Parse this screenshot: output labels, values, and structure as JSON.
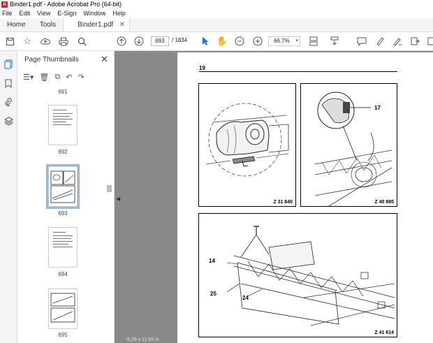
{
  "window": {
    "title": "Binder1.pdf - Adobe Acrobat Pro (64-bit)"
  },
  "menu": [
    "File",
    "Edit",
    "View",
    "E-Sign",
    "Window",
    "Help"
  ],
  "tabs": {
    "home": "Home",
    "tools": "Tools",
    "document": "Binder1.pdf"
  },
  "toolbar": {
    "current_page": "693",
    "page_count": "/ 1834",
    "zoom": "66.7%"
  },
  "thumbnails": {
    "title": "Page Thumbnails",
    "labels": [
      "691",
      "692",
      "693",
      "694",
      "695"
    ],
    "selected": "693"
  },
  "document_page": {
    "page_number": "19",
    "figures": {
      "top_left": {
        "ref": "Z 31 840"
      },
      "top_right": {
        "ref": "Z 40 985",
        "callout": "17"
      },
      "bottom": {
        "ref": "Z 41 614",
        "callouts": [
          "14",
          "25",
          "24"
        ]
      }
    }
  },
  "status": {
    "page_size": "8.26 x 11.69 in"
  },
  "icons": [
    "save-icon",
    "star-icon",
    "upload-icon",
    "print-icon",
    "search-icon",
    "prev-page-icon",
    "next-page-icon",
    "select-cursor-icon",
    "hand-icon",
    "zoom-out-icon",
    "zoom-in-icon",
    "page-layout-icon",
    "scroll-icon",
    "comment-icon",
    "highlight-icon",
    "sign-icon",
    "export-icon"
  ]
}
